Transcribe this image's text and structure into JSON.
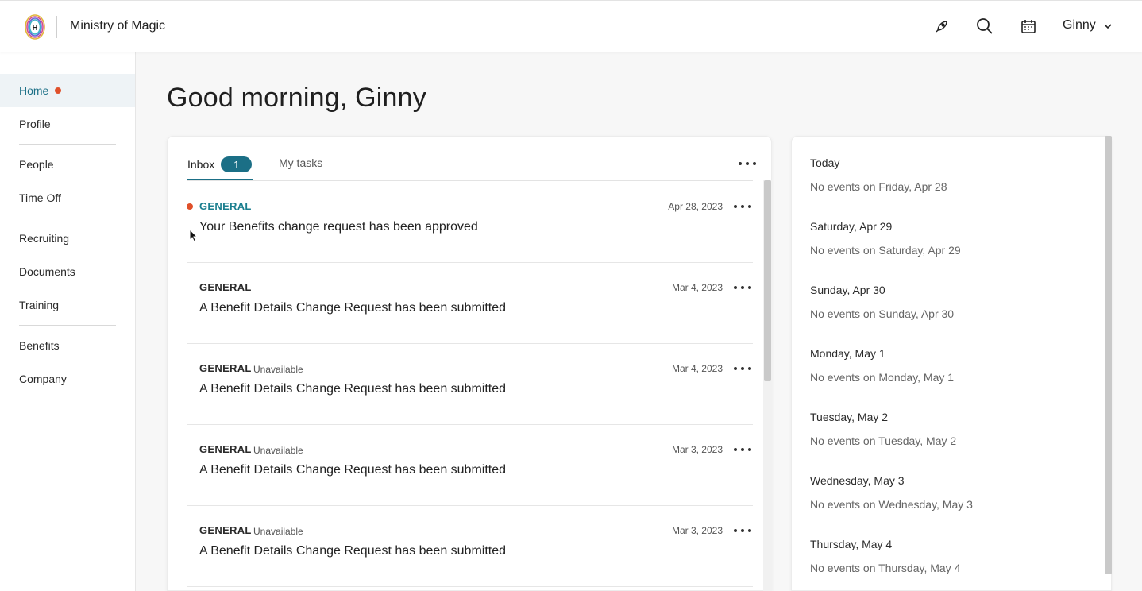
{
  "header": {
    "org_name": "Ministry of Magic",
    "user_name": "Ginny",
    "icons": [
      "rocket-icon",
      "search-icon",
      "calendar-icon",
      "chevron-down-icon"
    ]
  },
  "sidebar": {
    "items": [
      {
        "label": "Home",
        "active": true,
        "notification": true
      },
      {
        "label": "Profile"
      },
      {
        "label": "People"
      },
      {
        "label": "Time Off"
      },
      {
        "label": "Recruiting"
      },
      {
        "label": "Documents"
      },
      {
        "label": "Training"
      },
      {
        "label": "Benefits"
      },
      {
        "label": "Company"
      }
    ]
  },
  "main": {
    "greeting": "Good morning, Ginny",
    "inbox": {
      "tabs": {
        "inbox_label": "Inbox",
        "inbox_count": "1",
        "tasks_label": "My tasks"
      },
      "messages": [
        {
          "category": "GENERAL",
          "status": "",
          "date": "Apr 28, 2023",
          "title": "Your Benefits change request has been approved",
          "unread": true
        },
        {
          "category": "GENERAL",
          "status": "",
          "date": "Mar 4, 2023",
          "title": "A Benefit Details Change Request has been submitted",
          "unread": false
        },
        {
          "category": "GENERAL",
          "status": "Unavailable",
          "date": "Mar 4, 2023",
          "title": "A Benefit Details Change Request has been submitted",
          "unread": false
        },
        {
          "category": "GENERAL",
          "status": "Unavailable",
          "date": "Mar 3, 2023",
          "title": "A Benefit Details Change Request has been submitted",
          "unread": false
        },
        {
          "category": "GENERAL",
          "status": "Unavailable",
          "date": "Mar 3, 2023",
          "title": "A Benefit Details Change Request has been submitted",
          "unread": false
        }
      ]
    },
    "calendar": {
      "days": [
        {
          "label": "Today",
          "empty": "No events on Friday, Apr 28"
        },
        {
          "label": "Saturday, Apr 29",
          "empty": "No events on Saturday, Apr 29"
        },
        {
          "label": "Sunday, Apr 30",
          "empty": "No events on Sunday, Apr 30"
        },
        {
          "label": "Monday, May 1",
          "empty": "No events on Monday, May 1"
        },
        {
          "label": "Tuesday, May 2",
          "empty": "No events on Tuesday, May 2"
        },
        {
          "label": "Wednesday, May 3",
          "empty": "No events on Wednesday, May 3"
        },
        {
          "label": "Thursday, May 4",
          "empty": "No events on Thursday, May 4"
        }
      ]
    }
  },
  "colors": {
    "accent": "#1b6f86",
    "notification": "#e0502a",
    "category_unread": "#1b7f8f"
  }
}
